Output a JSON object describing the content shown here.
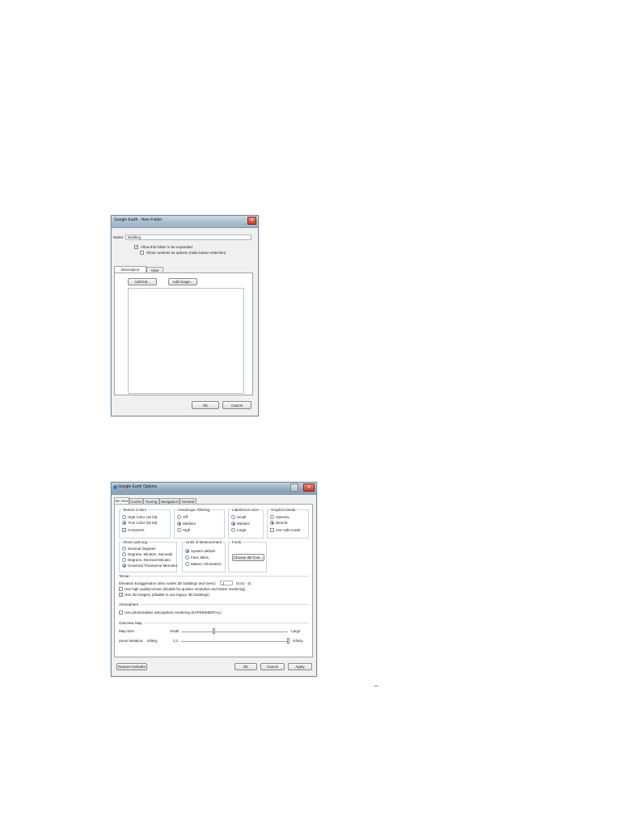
{
  "dialog1": {
    "title": "Google Earth - New Folder",
    "close": "×",
    "name_label": "Name:",
    "name_value": "Building",
    "allow_expand": "Allow this folder to be expanded",
    "show_contents": "Show contents as options (radio button selection)",
    "tabs": [
      "Description",
      "View"
    ],
    "add_link": "Add link...",
    "add_image": "Add image...",
    "ok": "OK",
    "cancel": "Cancel"
  },
  "dialog2": {
    "title": "Google Earth Options",
    "tabs": [
      "3D View",
      "Cache",
      "Touring",
      "Navigation",
      "General"
    ],
    "texture_colors": {
      "label": "Texture Colors",
      "options": [
        "High Color (16 bit)",
        "True Color (32 bit)"
      ],
      "compress": "Compress"
    },
    "anisotropic": {
      "label": "Anisotropic Filtering",
      "options": [
        "Off",
        "Medium",
        "High"
      ]
    },
    "labels_icon": {
      "label": "Labels/Icon Size",
      "options": [
        "Small",
        "Medium",
        "Large"
      ]
    },
    "graphics_mode": {
      "label": "Graphics Mode",
      "options": [
        "OpenGL",
        "DirectX"
      ],
      "safe_mode": "Use safe mode"
    },
    "show_latlong": {
      "label": "Show Lat/Long",
      "options": [
        "Decimal Degrees",
        "Degrees, Minutes, Seconds",
        "Degrees, Decimal Minutes",
        "Universal Transverse Mercator"
      ]
    },
    "units": {
      "label": "Units of Measurement",
      "options": [
        "System default",
        "Feet, Miles",
        "Meters, Kilometers"
      ]
    },
    "fonts": {
      "label": "Fonts",
      "choose": "Choose 3D Font..."
    },
    "terrain": {
      "label": "Terrain",
      "elevation_label": "Elevation Exaggeration (also scales 3D buildings and trees):",
      "elevation_value": "1",
      "elevation_range": "(0.01 - 3)",
      "high_quality": "Use high quality terrain (disable for quicker resolution and faster rendering)",
      "imagery_3d": "Use 3D Imagery (disable to use legacy 3D buildings)"
    },
    "atmosphere": {
      "label": "Atmosphere",
      "photo": "Use photorealistic atmosphere rendering (EXPERIMENTAL)"
    },
    "overview": {
      "label": "Overview Map",
      "map_size": "Map Size:",
      "small": "Small",
      "large": "Large",
      "zoom_relation": "Zoom Relation:",
      "zoom_value": "infinity",
      "one_to_one": "1:1",
      "infinity": "infinity"
    },
    "restore": "Restore Defaults",
    "ok": "OK",
    "cancel": "Cancel",
    "apply": "Apply"
  },
  "stray_mark": "_"
}
